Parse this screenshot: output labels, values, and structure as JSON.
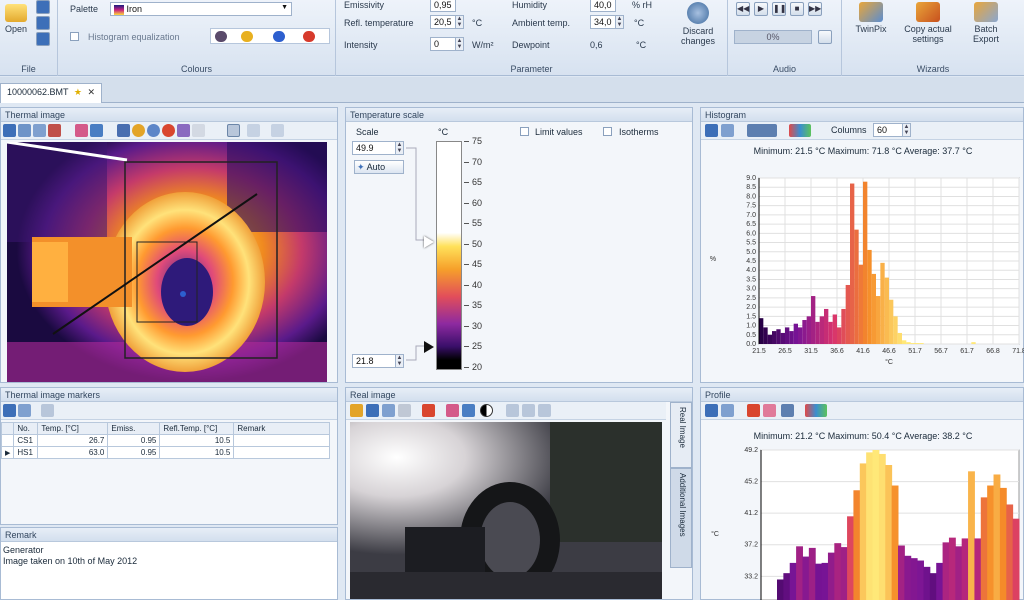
{
  "ribbon": {
    "file": {
      "open_label": "Open",
      "group_label": "File"
    },
    "colours": {
      "palette_label": "Palette",
      "palette_value": "Iron",
      "histogram_eq_label": "Histogram equalization",
      "group_label": "Colours"
    },
    "parameter": {
      "emissivity_label": "Emissivity",
      "emissivity_value": "0,95",
      "refl_temp_label": "Refl. temperature",
      "refl_temp_value": "20,5",
      "refl_temp_unit": "°C",
      "intensity_label": "Intensity",
      "intensity_value": "0",
      "intensity_unit": "W/m²",
      "humidity_label": "Humidity",
      "humidity_value": "40,0",
      "humidity_unit": "% rH",
      "ambient_label": "Ambient temp.",
      "ambient_value": "34,0",
      "ambient_unit": "°C",
      "dewpoint_label": "Dewpoint",
      "dewpoint_value": "0,6",
      "dewpoint_unit": "°C",
      "discard_label": "Discard changes",
      "group_label": "Parameter"
    },
    "audio": {
      "progress_text": "0%",
      "group_label": "Audio"
    },
    "wizards": {
      "twinpix_label": "TwinPix",
      "copy_label": "Copy actual settings",
      "batch_label": "Batch Export",
      "group_label": "Wizards"
    }
  },
  "doc_tab": {
    "label": "10000062.BMT"
  },
  "thermal_image": {
    "title": "Thermal image"
  },
  "temperature_scale": {
    "title": "Temperature scale",
    "scale_label": "Scale",
    "unit": "°C",
    "limit_values_label": "Limit values",
    "isotherms_label": "Isotherms",
    "max_value": "49.9",
    "min_value": "21.8",
    "auto_label": "Auto",
    "ticks": [
      "75",
      "70",
      "65",
      "60",
      "55",
      "50",
      "45",
      "40",
      "35",
      "30",
      "25",
      "20"
    ]
  },
  "histogram": {
    "title": "Histogram",
    "columns_label": "Columns",
    "columns_value": "60",
    "stats": "Minimum: 21.5 °C Maximum: 71.8 °C Average: 37.7 °C"
  },
  "markers": {
    "title": "Thermal image markers",
    "headers": [
      "No.",
      "Temp. [°C]",
      "Emiss.",
      "Refl.Temp. [°C]",
      "Remark"
    ],
    "rows": [
      [
        "CS1",
        "26.7",
        "0.95",
        "10.5",
        ""
      ],
      [
        "HS1",
        "63.0",
        "0.95",
        "10.5",
        ""
      ]
    ]
  },
  "remark": {
    "title": "Remark",
    "line1": "Generator",
    "line2": "Image taken on 10th of May 2012"
  },
  "real_image": {
    "title": "Real image",
    "side_tab1": "Real Image",
    "side_tab2": "Additional Images"
  },
  "profile": {
    "title": "Profile",
    "stats": "Minimum: 21.2 °C Maximum: 50.4 °C Average: 38.2 °C"
  },
  "chart_data": [
    {
      "type": "bar",
      "title": "Histogram",
      "xlabel": "°C",
      "ylabel": "%",
      "ylim": [
        0,
        9
      ],
      "x_ticks": [
        "21.5",
        "26.5",
        "31.5",
        "36.6",
        "41.6",
        "46.6",
        "51.7",
        "56.7",
        "61.7",
        "66.8",
        "71.8"
      ],
      "y_ticks": [
        "0.0",
        "0.5",
        "1.0",
        "1.5",
        "2.0",
        "2.5",
        "3.0",
        "3.5",
        "4.0",
        "4.5",
        "5.0",
        "5.5",
        "6.0",
        "6.5",
        "7.0",
        "7.5",
        "8.0",
        "8.5",
        "9.0"
      ],
      "values": [
        1.4,
        0.9,
        0.5,
        0.7,
        0.8,
        0.6,
        0.9,
        0.7,
        1.1,
        0.9,
        1.3,
        1.5,
        2.6,
        1.2,
        1.5,
        1.9,
        1.2,
        1.6,
        0.9,
        1.9,
        3.2,
        8.7,
        6.2,
        4.3,
        8.8,
        5.1,
        3.8,
        2.6,
        4.4,
        3.6,
        2.4,
        1.5,
        0.6,
        0.2,
        0.1,
        0.05,
        0.05,
        0.05,
        0.0,
        0.0,
        0.0,
        0.0,
        0.0,
        0.0,
        0.0,
        0.0,
        0.0,
        0.0,
        0.0,
        0.1,
        0.0,
        0.0,
        0.0,
        0.0,
        0.0,
        0.0,
        0.0,
        0.0,
        0.0,
        0.0
      ],
      "grid": true
    },
    {
      "type": "area",
      "title": "Profile",
      "ylabel": "°C",
      "ylim": [
        30.2,
        49.2
      ],
      "y_ticks": [
        "49.2",
        "45.2",
        "41.2",
        "37.2",
        "33.2"
      ],
      "values": [
        32.8,
        33.6,
        34.9,
        37.0,
        35.7,
        36.8,
        34.8,
        34.9,
        36.2,
        37.4,
        36.9,
        40.8,
        44.1,
        47.5,
        48.9,
        49.2,
        48.7,
        47.3,
        44.7,
        37.1,
        35.8,
        35.5,
        35.2,
        34.4,
        33.6,
        34.9,
        37.5,
        38.1,
        37.0,
        38.0,
        46.5,
        38.0,
        43.2,
        44.7,
        46.1,
        44.4,
        42.3,
        40.5
      ],
      "grid": true
    }
  ]
}
